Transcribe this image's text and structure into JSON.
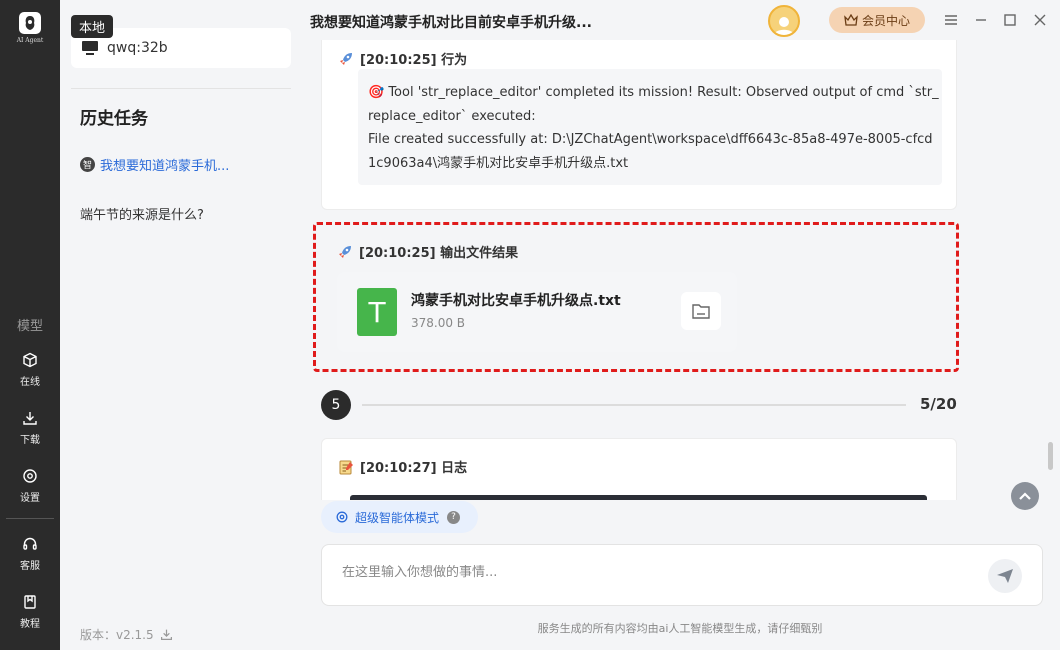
{
  "rail": {
    "brand": "AI Agent",
    "section_label": "模型",
    "items": [
      {
        "label": "在线",
        "icon": "cube-icon"
      },
      {
        "label": "下载",
        "icon": "download-icon"
      },
      {
        "label": "设置",
        "icon": "settings-icon"
      },
      {
        "label": "客服",
        "icon": "headset-icon"
      },
      {
        "label": "教程",
        "icon": "book-icon"
      }
    ]
  },
  "sidebar": {
    "local_tag": "本地",
    "model_name": "qwq:32b",
    "history_title": "历史任务",
    "history": [
      {
        "badge": "智",
        "text": "我想要知道鸿蒙手机...",
        "active": true
      },
      {
        "badge": "",
        "text": "端午节的来源是什么?",
        "active": false
      }
    ],
    "version": "版本：v2.1.5"
  },
  "topbar": {
    "title": "我想要知道鸿蒙手机对比目前安卓手机升级...",
    "vip_label": "会员中心"
  },
  "cards": {
    "action": {
      "header": "[20:10:25] 行为",
      "lines": [
        "🎯 Tool 'str_replace_editor' completed its mission! Result: Observed output of cmd `str_",
        "replace_editor` executed:",
        "File created successfully at: D:\\JZChatAgent\\workspace\\dff6643c-85a8-497e-8005-cfcd",
        "1c9063a4\\鸿蒙手机对比安卓手机升级点.txt"
      ]
    },
    "output": {
      "header": "[20:10:25] 输出文件结果",
      "file_icon_letter": "T",
      "file_name": "鸿蒙手机对比安卓手机升级点.txt",
      "file_size": "378.00 B"
    },
    "step": {
      "number": "5",
      "count": "5/20"
    },
    "log": {
      "header": "[20:10:27] 日志"
    }
  },
  "input": {
    "mode_label": "超级智能体模式",
    "placeholder": "在这里输入你想做的事情...",
    "footer": "服务生成的所有内容均由ai人工智能模型生成，请仔细甄别"
  },
  "colors": {
    "rail_bg": "#2b2b2b",
    "accent_blue": "#2a6ad8",
    "highlight_red": "#e01b1b",
    "file_green": "#46b54b",
    "vip_bg": "#f5d3b3"
  }
}
